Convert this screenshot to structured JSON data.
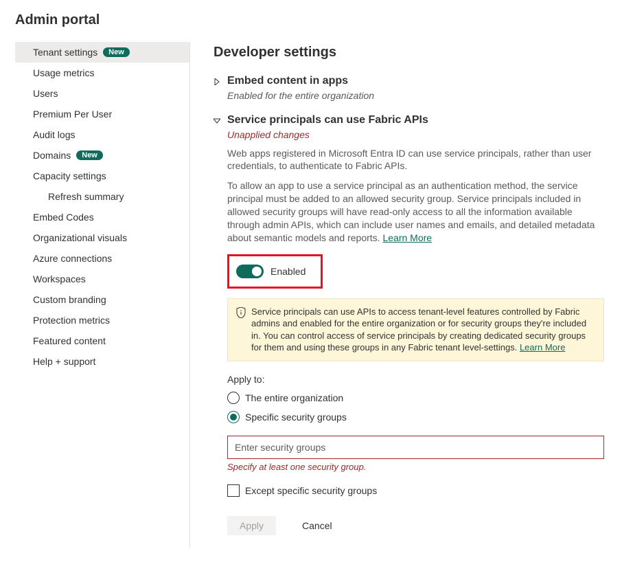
{
  "header": {
    "title": "Admin portal"
  },
  "sidebar": {
    "items": [
      {
        "label": "Tenant settings",
        "badge": "New",
        "active": true
      },
      {
        "label": "Usage metrics"
      },
      {
        "label": "Users"
      },
      {
        "label": "Premium Per User"
      },
      {
        "label": "Audit logs"
      },
      {
        "label": "Domains",
        "badge": "New"
      },
      {
        "label": "Capacity settings"
      },
      {
        "label": "Refresh summary",
        "sub": true
      },
      {
        "label": "Embed Codes"
      },
      {
        "label": "Organizational visuals"
      },
      {
        "label": "Azure connections"
      },
      {
        "label": "Workspaces"
      },
      {
        "label": "Custom branding"
      },
      {
        "label": "Protection metrics"
      },
      {
        "label": "Featured content"
      },
      {
        "label": "Help + support"
      }
    ]
  },
  "main": {
    "section_title": "Developer settings",
    "setting1": {
      "title": "Embed content in apps",
      "status": "Enabled for the entire organization"
    },
    "setting2": {
      "title": "Service principals can use Fabric APIs",
      "status": "Unapplied changes",
      "desc1": "Web apps registered in Microsoft Entra ID can use service principals, rather than user credentials, to authenticate to Fabric APIs.",
      "desc2": "To allow an app to use a service principal as an authentication method, the service principal must be added to an allowed security group. Service principals included in allowed security groups will have read-only access to all the information available through admin APIs, which can include user names and emails, and detailed metadata about semantic models and reports.  ",
      "learn_more": "Learn More",
      "toggle_label": "Enabled",
      "info_text": "Service principals can use APIs to access tenant-level features controlled by Fabric admins and enabled for the entire organization or for security groups they're included in. You can control access of service principals by creating dedicated security groups for them and using these groups in any Fabric tenant level-settings.  ",
      "info_learn_more": "Learn More",
      "apply_label": "Apply to:",
      "radio_entire": "The entire organization",
      "radio_specific": "Specific security groups",
      "input_placeholder": "Enter security groups",
      "input_error": "Specify at least one security group.",
      "except_label": "Except specific security groups",
      "btn_apply": "Apply",
      "btn_cancel": "Cancel"
    }
  }
}
